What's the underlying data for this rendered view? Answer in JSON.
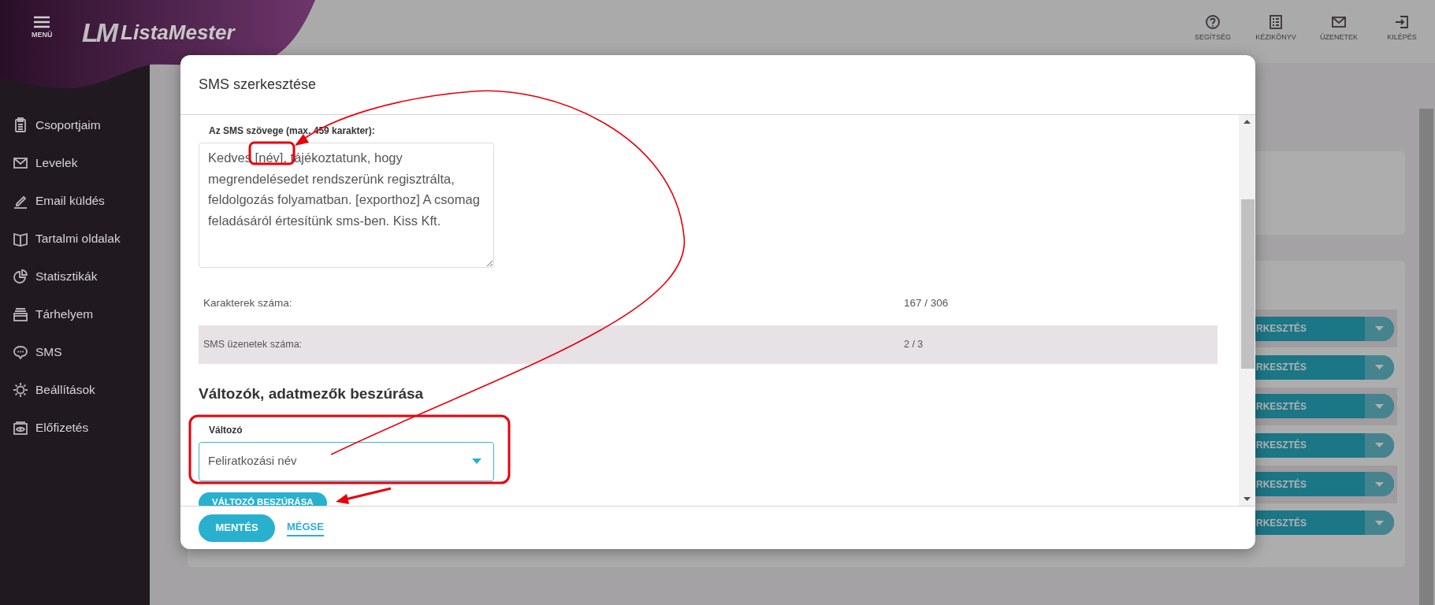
{
  "header": {
    "menu_label": "MENÜ",
    "logo_mark": "LM",
    "logo": "ListaMester",
    "actions": [
      {
        "label": "SEGÍTSÉG",
        "kind": "help"
      },
      {
        "label": "KÉZIKÖNYV",
        "kind": "list"
      },
      {
        "label": "ÜZENETEK",
        "kind": "mail"
      },
      {
        "label": "KILÉPÉS",
        "kind": "exit"
      }
    ]
  },
  "sidebar": {
    "items": [
      {
        "label": "Csoportjaim",
        "kind": "clipboard"
      },
      {
        "label": "Levelek",
        "kind": "mail"
      },
      {
        "label": "Email küldés",
        "kind": "pencil"
      },
      {
        "label": "Tartalmi oldalak",
        "kind": "book"
      },
      {
        "label": "Statisztikák",
        "kind": "pie"
      },
      {
        "label": "Tárhelyem",
        "kind": "stack"
      },
      {
        "label": "SMS",
        "kind": "chat"
      },
      {
        "label": "Beállítások",
        "kind": "gear"
      },
      {
        "label": "Előfizetés",
        "kind": "eye"
      }
    ]
  },
  "background": {
    "rows": [
      {
        "button": "RKESZTÉS",
        "shaded": true
      },
      {
        "button": "RKESZTÉS",
        "shaded": false
      },
      {
        "button": "RKESZTÉS",
        "shaded": true
      },
      {
        "button": "RKESZTÉS",
        "shaded": false
      },
      {
        "button": "RKESZTÉS",
        "shaded": true
      },
      {
        "button": "RKESZTÉS",
        "shaded": false
      }
    ]
  },
  "modal": {
    "title": "SMS szerkesztése",
    "text_label": "Az SMS szövege (max. 459 karakter):",
    "text_value": "Kedves [név], tájékoztatunk, hogy megrendelésedet rendszerünk regisztrálta, feldolgozás folyamatban. [exporthoz] A csomag feladásáról értesítünk sms-ben. Kiss Kft.",
    "stats": [
      {
        "label": "Karakterek száma:",
        "value": "167 / 306",
        "shaded": false
      },
      {
        "label": "SMS üzenetek száma:",
        "value": "2 / 3",
        "shaded": true
      }
    ],
    "section_title": "Változók, adatmezők beszúrása",
    "variable": {
      "label": "Változó",
      "value": "Feliratkozási név"
    },
    "insert_button": "VÁLTOZÓ BESZÚRÁSA",
    "save_button": "MENTÉS",
    "cancel_link": "MÉGSE"
  }
}
